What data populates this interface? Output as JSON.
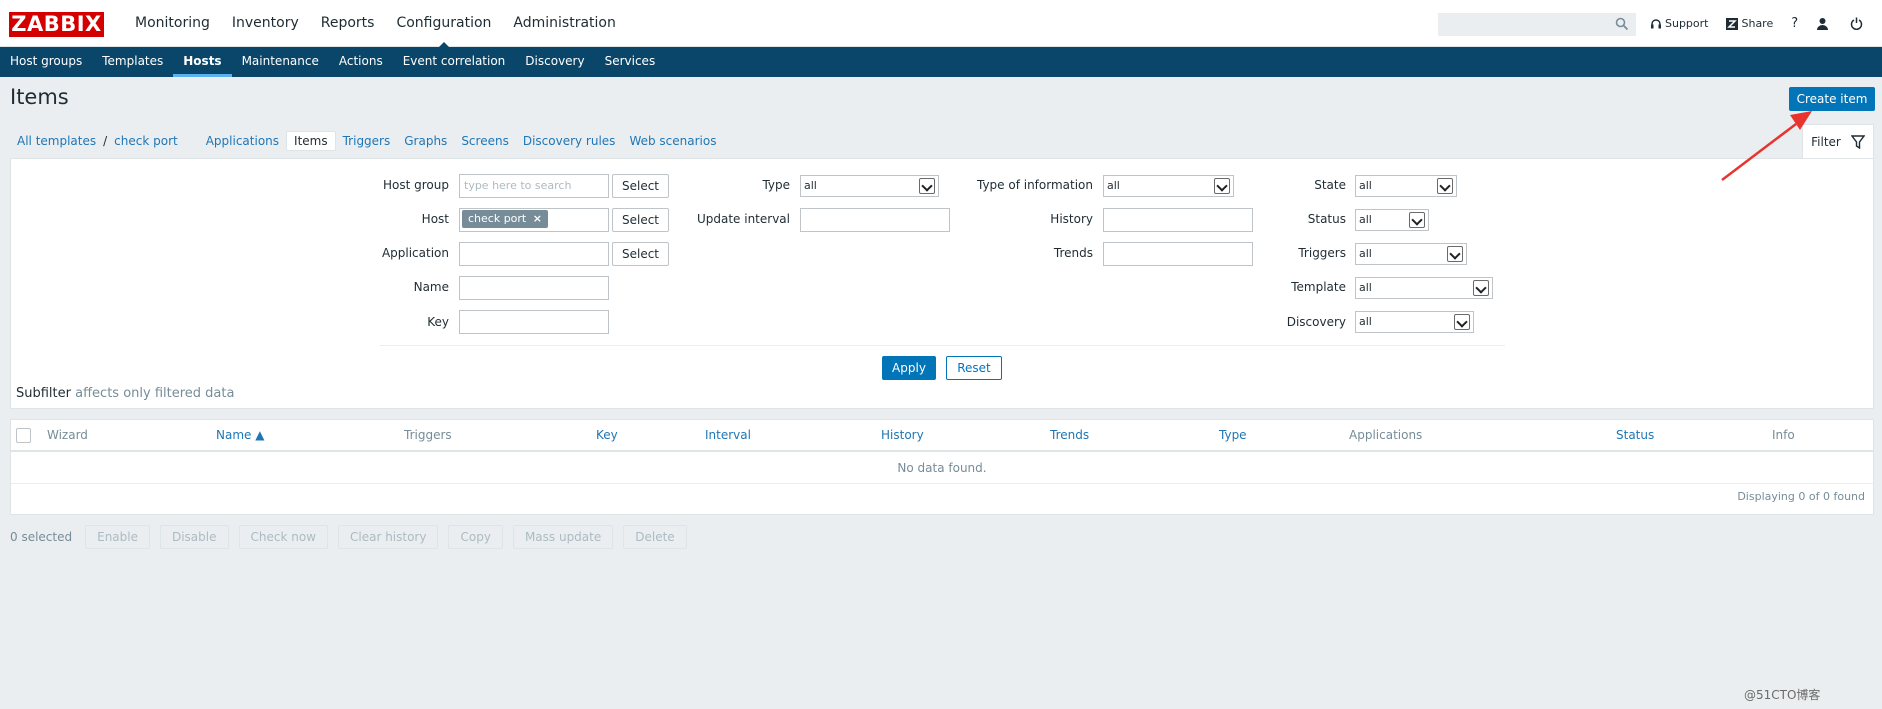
{
  "brand": {
    "logo_text": "ZABBIX",
    "color": "#d40000"
  },
  "top_nav": {
    "items": [
      "Monitoring",
      "Inventory",
      "Reports",
      "Configuration",
      "Administration"
    ],
    "active": "Configuration"
  },
  "search": {
    "placeholder": "",
    "icon": "search-icon"
  },
  "top_links": {
    "support": "Support",
    "share": "Share",
    "help": "?",
    "help_icon": "help-icon",
    "profile_icon": "user-icon",
    "logout_icon": "power-icon"
  },
  "sub_nav": {
    "items": [
      "Host groups",
      "Templates",
      "Hosts",
      "Maintenance",
      "Actions",
      "Event correlation",
      "Discovery",
      "Services"
    ],
    "active": "Hosts"
  },
  "page": {
    "title": "Items",
    "create_button": "Create item"
  },
  "breadcrumb": {
    "all_templates": "All templates",
    "separator": "/",
    "host": "check port"
  },
  "tabs": {
    "items": [
      "Applications",
      "Items",
      "Triggers",
      "Graphs",
      "Screens",
      "Discovery rules",
      "Web scenarios"
    ],
    "active": "Items"
  },
  "filter": {
    "tab_label": "Filter",
    "host_group": {
      "label": "Host group",
      "placeholder": "type here to search",
      "button": "Select"
    },
    "host": {
      "label": "Host",
      "tag": "check port",
      "tag_close": "×",
      "button": "Select"
    },
    "application": {
      "label": "Application",
      "value": "",
      "button": "Select"
    },
    "name": {
      "label": "Name",
      "value": ""
    },
    "key": {
      "label": "Key",
      "value": ""
    },
    "type": {
      "label": "Type",
      "value": "all"
    },
    "update_interval": {
      "label": "Update interval",
      "value": ""
    },
    "type_of_information": {
      "label": "Type of information",
      "value": "all"
    },
    "history": {
      "label": "History",
      "value": ""
    },
    "trends": {
      "label": "Trends",
      "value": ""
    },
    "state": {
      "label": "State",
      "value": "all"
    },
    "status": {
      "label": "Status",
      "value": "all"
    },
    "triggers": {
      "label": "Triggers",
      "value": "all"
    },
    "template": {
      "label": "Template",
      "value": "all"
    },
    "discovery": {
      "label": "Discovery",
      "value": "all"
    },
    "apply": "Apply",
    "reset": "Reset"
  },
  "subfilter": {
    "label": "Subfilter",
    "note": "affects only filtered data"
  },
  "table": {
    "columns": [
      "Wizard",
      "Name ▲",
      "Triggers",
      "Key",
      "Interval",
      "History",
      "Trends",
      "Type",
      "Applications",
      "Status",
      "Info"
    ],
    "empty_message": "No data found.",
    "footer": "Displaying 0 of 0 found"
  },
  "actions": {
    "selected_count": "0 selected",
    "buttons": [
      "Enable",
      "Disable",
      "Check now",
      "Clear history",
      "Copy",
      "Mass update",
      "Delete"
    ]
  },
  "watermark": "@51CTO博客",
  "colors": {
    "nav_bg": "#0a466a",
    "primary_button": "#0275b8",
    "link": "#1f76b5",
    "annotation_arrow": "#e8342f"
  }
}
